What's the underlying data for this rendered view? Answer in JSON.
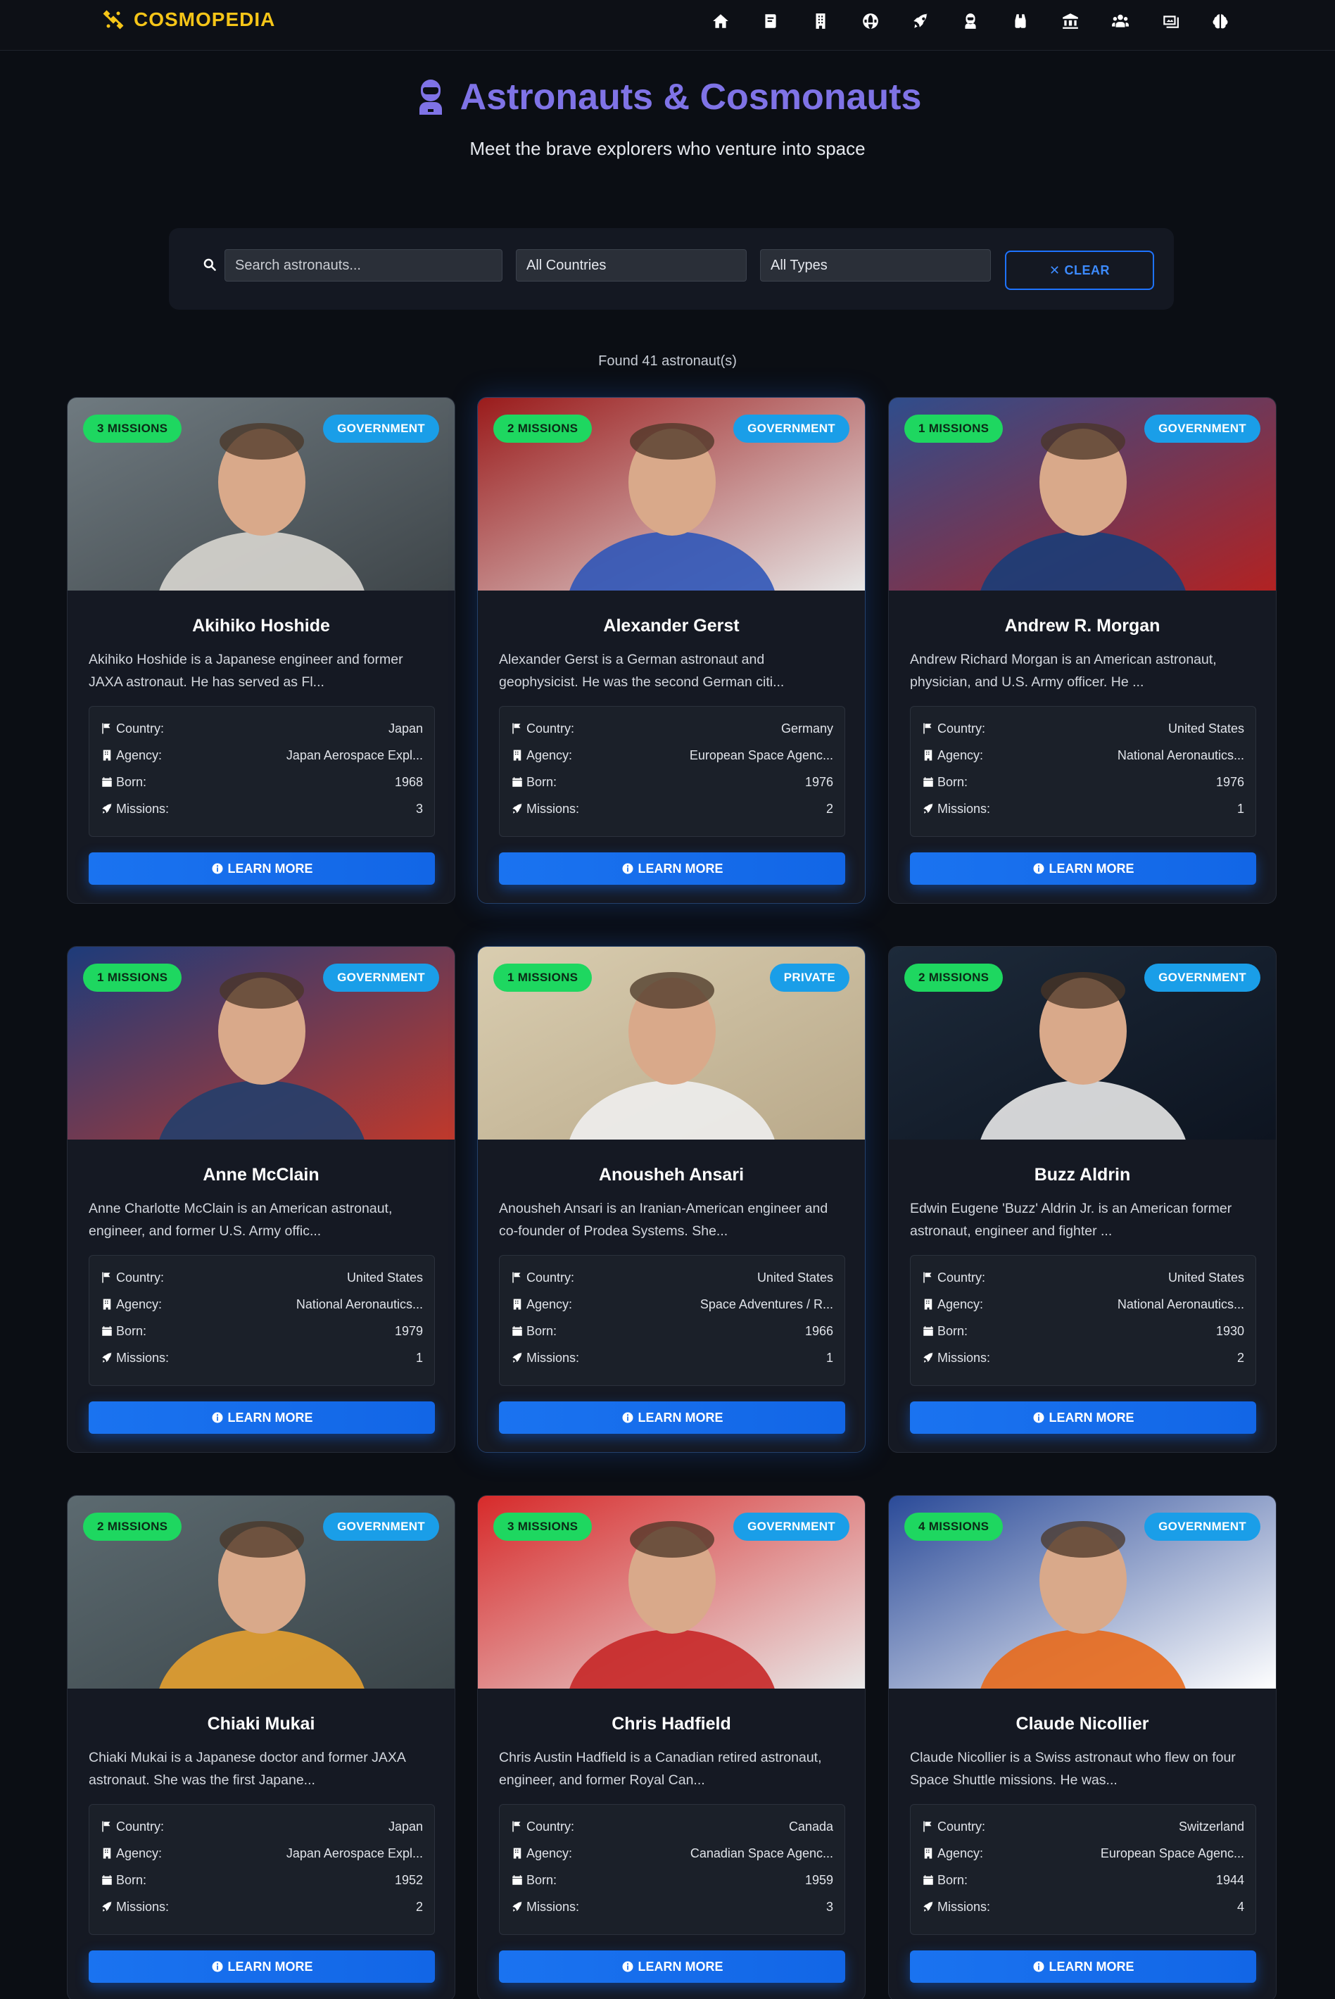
{
  "brand": {
    "name": "COSMOPEDIA"
  },
  "nav": {
    "icons": [
      "home-icon",
      "book-icon",
      "building-icon",
      "globe-icon",
      "rocket-icon",
      "astronaut-icon",
      "binoculars-icon",
      "landmark-icon",
      "users-icon",
      "images-icon",
      "brain-icon"
    ]
  },
  "hero": {
    "title": "Astronauts & Cosmonauts",
    "subtitle": "Meet the brave explorers who venture into space"
  },
  "filters": {
    "search_placeholder": "Search astronauts...",
    "country_value": "All Countries",
    "type_value": "All Types",
    "clear_label": "CLEAR"
  },
  "results": {
    "found_text": "Found 41 astronaut(s)"
  },
  "labels": {
    "country": "Country:",
    "agency": "Agency:",
    "born": "Born:",
    "missions": "Missions:",
    "learn_more": "LEARN MORE"
  },
  "colors": {
    "accent": "#1a73f0",
    "missions_badge": "#1ed760",
    "type_badge": "#1a9ee8",
    "title": "#7f73e6",
    "brand": "#f5c518"
  },
  "astronauts": [
    {
      "missions_badge": "3 MISSIONS",
      "type_badge": "GOVERNMENT",
      "name": "Akihiko Hoshide",
      "description": "Akihiko Hoshide is a Japanese engineer and former JAXA astronaut. He has served as Fl...",
      "country": "Japan",
      "agency": "Japan Aerospace Expl...",
      "born": "1968",
      "missions": "3"
    },
    {
      "missions_badge": "2 MISSIONS",
      "type_badge": "GOVERNMENT",
      "name": "Alexander Gerst",
      "description": "Alexander Gerst is a German astronaut and geophysicist. He was the second German citi...",
      "country": "Germany",
      "agency": "European Space Agenc...",
      "born": "1976",
      "missions": "2"
    },
    {
      "missions_badge": "1 MISSIONS",
      "type_badge": "GOVERNMENT",
      "name": "Andrew R. Morgan",
      "description": "Andrew Richard Morgan is an American astronaut, physician, and U.S. Army officer. He ...",
      "country": "United States",
      "agency": "National Aeronautics...",
      "born": "1976",
      "missions": "1"
    },
    {
      "missions_badge": "1 MISSIONS",
      "type_badge": "GOVERNMENT",
      "name": "Anne McClain",
      "description": "Anne Charlotte McClain is an American astronaut, engineer, and former U.S. Army offic...",
      "country": "United States",
      "agency": "National Aeronautics...",
      "born": "1979",
      "missions": "1"
    },
    {
      "missions_badge": "1 MISSIONS",
      "type_badge": "PRIVATE",
      "name": "Anousheh Ansari",
      "description": "Anousheh Ansari is an Iranian-American engineer and co-founder of Prodea Systems. She...",
      "country": "United States",
      "agency": "Space Adventures / R...",
      "born": "1966",
      "missions": "1"
    },
    {
      "missions_badge": "2 MISSIONS",
      "type_badge": "GOVERNMENT",
      "name": "Buzz Aldrin",
      "description": "Edwin Eugene 'Buzz' Aldrin Jr. is an American former astronaut, engineer and fighter ...",
      "country": "United States",
      "agency": "National Aeronautics...",
      "born": "1930",
      "missions": "2"
    },
    {
      "missions_badge": "2 MISSIONS",
      "type_badge": "GOVERNMENT",
      "name": "Chiaki Mukai",
      "description": "Chiaki Mukai is a Japanese doctor and former JAXA astronaut. She was the first Japane...",
      "country": "Japan",
      "agency": "Japan Aerospace Expl...",
      "born": "1952",
      "missions": "2"
    },
    {
      "missions_badge": "3 MISSIONS",
      "type_badge": "GOVERNMENT",
      "name": "Chris Hadfield",
      "description": "Chris Austin Hadfield is a Canadian retired astronaut, engineer, and former Royal Can...",
      "country": "Canada",
      "agency": "Canadian Space Agenc...",
      "born": "1959",
      "missions": "3"
    },
    {
      "missions_badge": "4 MISSIONS",
      "type_badge": "GOVERNMENT",
      "name": "Claude Nicollier",
      "description": "Claude Nicollier is a Swiss astronaut who flew on four Space Shuttle missions. He was...",
      "country": "Switzerland",
      "agency": "European Space Agenc...",
      "born": "1944",
      "missions": "4"
    }
  ]
}
